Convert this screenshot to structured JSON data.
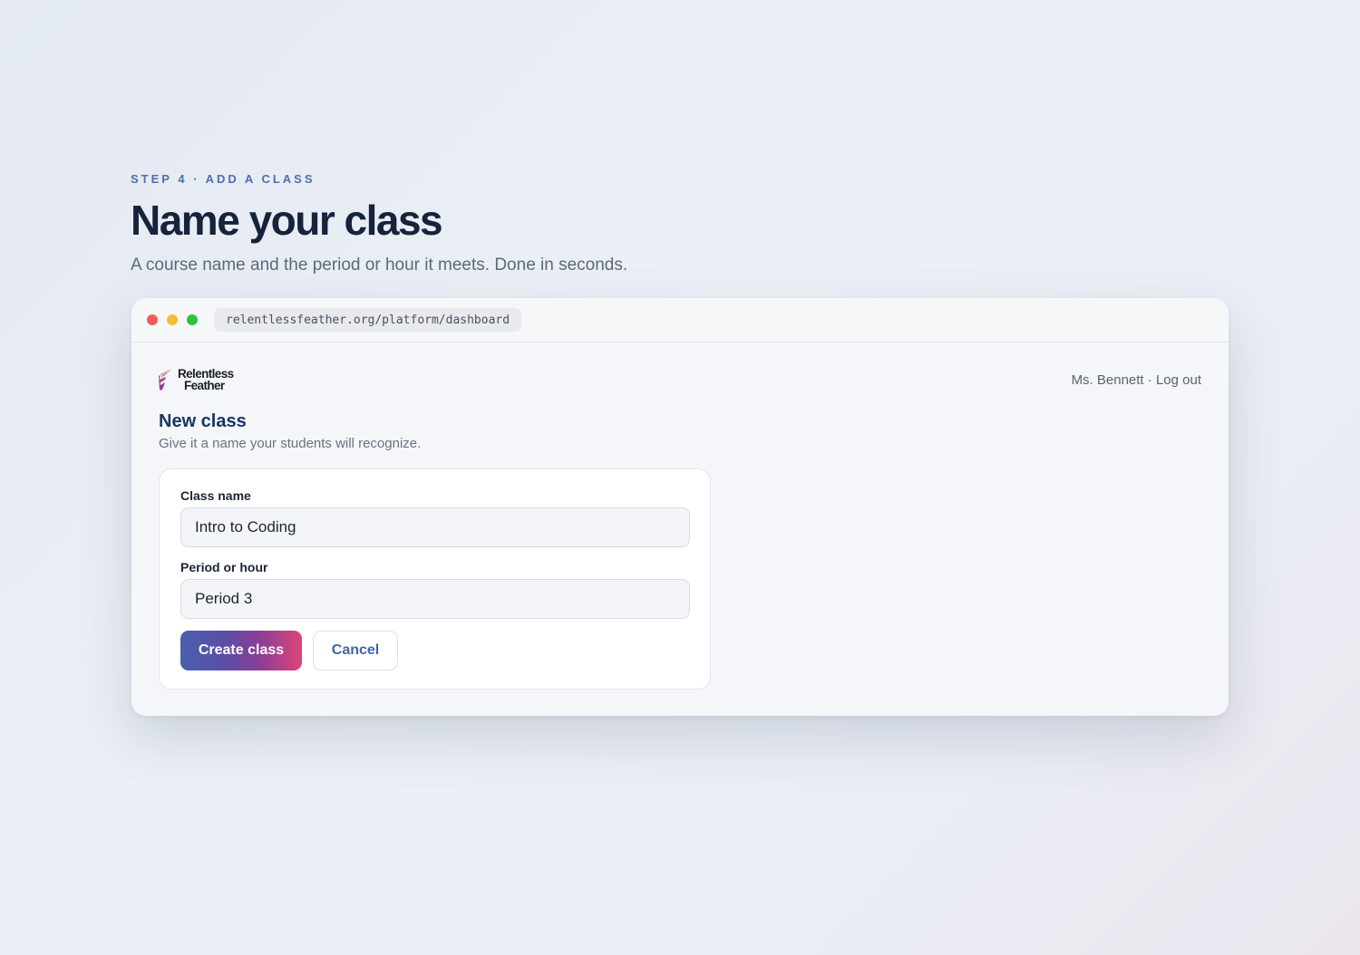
{
  "hero": {
    "step_label": "STEP 4 · ADD A CLASS",
    "title": "Name your class",
    "subtitle": "A course name and the period or hour it meets. Done in seconds."
  },
  "browser": {
    "url": "relentlessfeather.org/platform/dashboard",
    "window_controls": [
      "close",
      "minimize",
      "maximize"
    ]
  },
  "app": {
    "logo": {
      "line1": "Relentless",
      "line2": "Feather"
    },
    "user_name": "Ms. Bennett",
    "separator": " · ",
    "logout_label": "Log out",
    "section_title": "New class",
    "section_subtitle": "Give it a name your students will recognize.",
    "form": {
      "class_name_label": "Class name",
      "class_name_value": "Intro to Coding",
      "period_label": "Period or hour",
      "period_value": "Period 3",
      "create_label": "Create class",
      "cancel_label": "Cancel"
    }
  },
  "colors": {
    "accent_blue": "#4c6fad",
    "title_navy": "#15233b",
    "brand_gradient": [
      "#4960ae",
      "#8a3e96",
      "#de4478"
    ]
  }
}
